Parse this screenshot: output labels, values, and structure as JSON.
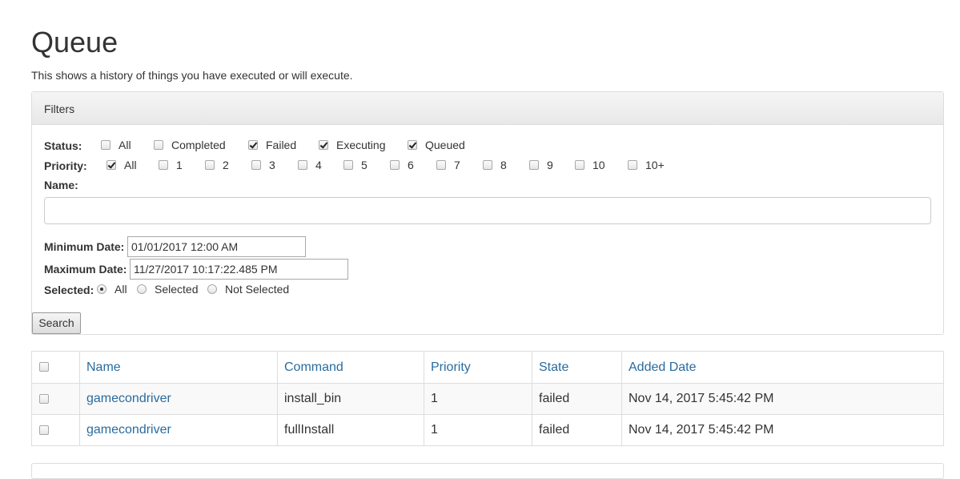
{
  "page": {
    "title": "Queue",
    "subtitle": "This shows a history of things you have executed or will execute."
  },
  "filters": {
    "heading": "Filters",
    "status": {
      "label": "Status:",
      "options": [
        {
          "label": "All",
          "checked": false
        },
        {
          "label": "Completed",
          "checked": false
        },
        {
          "label": "Failed",
          "checked": true
        },
        {
          "label": "Executing",
          "checked": true
        },
        {
          "label": "Queued",
          "checked": true
        }
      ]
    },
    "priority": {
      "label": "Priority:",
      "options": [
        {
          "label": "All",
          "checked": true
        },
        {
          "label": "1",
          "checked": false
        },
        {
          "label": "2",
          "checked": false
        },
        {
          "label": "3",
          "checked": false
        },
        {
          "label": "4",
          "checked": false
        },
        {
          "label": "5",
          "checked": false
        },
        {
          "label": "6",
          "checked": false
        },
        {
          "label": "7",
          "checked": false
        },
        {
          "label": "8",
          "checked": false
        },
        {
          "label": "9",
          "checked": false
        },
        {
          "label": "10",
          "checked": false
        },
        {
          "label": "10+",
          "checked": false
        }
      ]
    },
    "name": {
      "label": "Name:",
      "value": ""
    },
    "min_date": {
      "label": "Minimum Date:",
      "value": "01/01/2017 12:00 AM"
    },
    "max_date": {
      "label": "Maximum Date:",
      "value": "11/27/2017 10:17:22.485 PM"
    },
    "selected": {
      "label": "Selected:",
      "options": [
        {
          "label": "All",
          "checked": true
        },
        {
          "label": "Selected",
          "checked": false
        },
        {
          "label": "Not Selected",
          "checked": false
        }
      ]
    },
    "search_label": "Search"
  },
  "table": {
    "columns": [
      "Name",
      "Command",
      "Priority",
      "State",
      "Added Date"
    ],
    "rows": [
      {
        "name": "gamecondriver",
        "command": "install_bin",
        "priority": "1",
        "state": "failed",
        "added": "Nov 14, 2017 5:45:42 PM"
      },
      {
        "name": "gamecondriver",
        "command": "fullInstall",
        "priority": "1",
        "state": "failed",
        "added": "Nov 14, 2017 5:45:42 PM"
      }
    ]
  }
}
